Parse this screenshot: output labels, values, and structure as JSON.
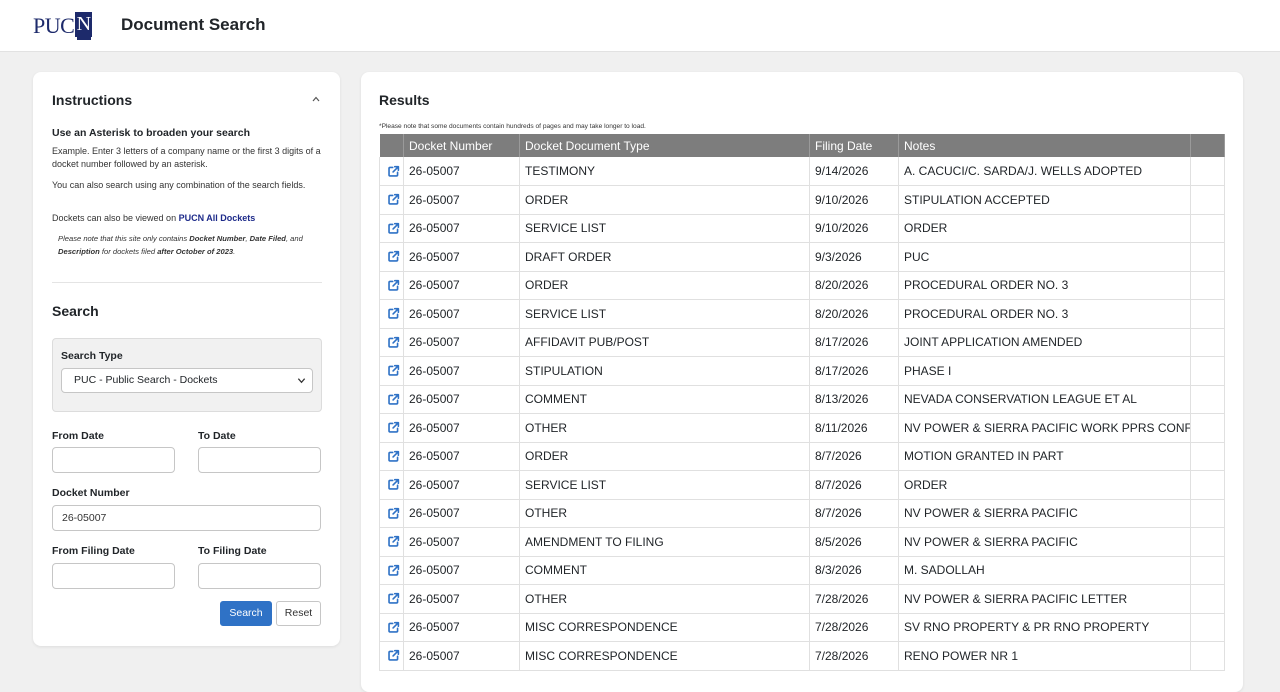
{
  "header": {
    "logo_text": "PUCN",
    "logo_main": "PUC",
    "logo_last": "N",
    "title": "Document Search"
  },
  "instructions": {
    "title": "Instructions",
    "heading": "Use an Asterisk to broaden your search",
    "example": "Example. Enter 3 letters of a company name or the first 3 digits of a docket number followed by an asterisk.",
    "combination": "You can also search using any combination of the search fields.",
    "dockets_prefix": "Dockets can also be viewed on ",
    "dockets_link": "PUCN All Dockets",
    "note_1": "Please note that this site only contains ",
    "note_docket": "Docket Number",
    "note_2": ", ",
    "note_date": "Date Filed",
    "note_3": ", and ",
    "note_desc": "Description",
    "note_4": " for dockets filed ",
    "note_after": "after October of 2023",
    "note_5": "."
  },
  "search": {
    "title": "Search",
    "type_label": "Search Type",
    "type_value": "PUC - Public Search - Dockets",
    "from_date_label": "From Date",
    "from_date_value": "",
    "to_date_label": "To Date",
    "to_date_value": "",
    "docket_label": "Docket Number",
    "docket_value": "26-05007",
    "from_filing_label": "From Filing Date",
    "from_filing_value": "",
    "to_filing_label": "To Filing Date",
    "to_filing_value": "",
    "search_button": "Search",
    "reset_button": "Reset"
  },
  "results": {
    "title": "Results",
    "note": "*Please note that some documents contain hundreds of pages and may take longer to load.",
    "columns": [
      "",
      "Docket Number",
      "Docket Document Type",
      "Filing Date",
      "Notes",
      ""
    ],
    "rows": [
      {
        "docket": "26-05007",
        "type": "TESTIMONY",
        "date": "9/14/2026",
        "notes": "A. CACUCI/C. SARDA/J. WELLS ADOPTED"
      },
      {
        "docket": "26-05007",
        "type": "ORDER",
        "date": "9/10/2026",
        "notes": "STIPULATION ACCEPTED"
      },
      {
        "docket": "26-05007",
        "type": "SERVICE LIST",
        "date": "9/10/2026",
        "notes": "ORDER"
      },
      {
        "docket": "26-05007",
        "type": "DRAFT ORDER",
        "date": "9/3/2026",
        "notes": "PUC"
      },
      {
        "docket": "26-05007",
        "type": "ORDER",
        "date": "8/20/2026",
        "notes": "PROCEDURAL ORDER NO. 3"
      },
      {
        "docket": "26-05007",
        "type": "SERVICE LIST",
        "date": "8/20/2026",
        "notes": "PROCEDURAL ORDER NO. 3"
      },
      {
        "docket": "26-05007",
        "type": "AFFIDAVIT PUB/POST",
        "date": "8/17/2026",
        "notes": "JOINT APPLICATION AMENDED"
      },
      {
        "docket": "26-05007",
        "type": "STIPULATION",
        "date": "8/17/2026",
        "notes": "PHASE I"
      },
      {
        "docket": "26-05007",
        "type": "COMMENT",
        "date": "8/13/2026",
        "notes": "NEVADA CONSERVATION LEAGUE ET AL"
      },
      {
        "docket": "26-05007",
        "type": "OTHER",
        "date": "8/11/2026",
        "notes": "NV POWER & SIERRA PACIFIC WORK PPRS CONF"
      },
      {
        "docket": "26-05007",
        "type": "ORDER",
        "date": "8/7/2026",
        "notes": "MOTION GRANTED IN PART"
      },
      {
        "docket": "26-05007",
        "type": "SERVICE LIST",
        "date": "8/7/2026",
        "notes": "ORDER"
      },
      {
        "docket": "26-05007",
        "type": "OTHER",
        "date": "8/7/2026",
        "notes": "NV POWER & SIERRA PACIFIC"
      },
      {
        "docket": "26-05007",
        "type": "AMENDMENT TO FILING",
        "date": "8/5/2026",
        "notes": "NV POWER & SIERRA PACIFIC"
      },
      {
        "docket": "26-05007",
        "type": "COMMENT",
        "date": "8/3/2026",
        "notes": "M. SADOLLAH"
      },
      {
        "docket": "26-05007",
        "type": "OTHER",
        "date": "7/28/2026",
        "notes": "NV POWER & SIERRA PACIFIC LETTER"
      },
      {
        "docket": "26-05007",
        "type": "MISC CORRESPONDENCE",
        "date": "7/28/2026",
        "notes": "SV RNO PROPERTY & PR RNO PROPERTY"
      },
      {
        "docket": "26-05007",
        "type": "MISC CORRESPONDENCE",
        "date": "7/28/2026",
        "notes": "RENO POWER NR 1"
      }
    ]
  },
  "colors": {
    "brand": "#1d2a6b",
    "primary_button": "#2f72c6",
    "table_header": "#7d7d7d",
    "link_icon": "#2f72c6"
  },
  "icons": {
    "row_link": "external-link-icon",
    "collapse": "chevron-up-icon",
    "select": "chevron-down-icon"
  }
}
